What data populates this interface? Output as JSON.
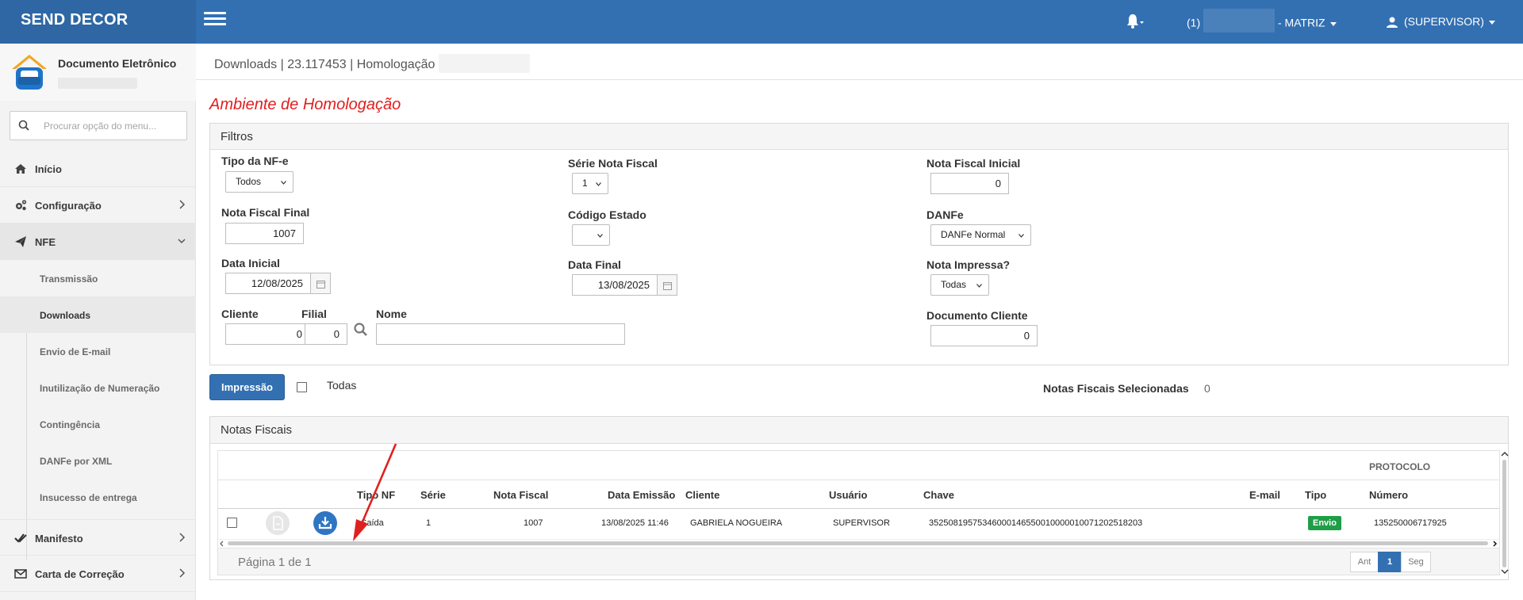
{
  "app": {
    "brand": "SEND DECOR",
    "company": "(1)",
    "company_suffix": "- MATRIZ",
    "user": "(SUPERVISOR)"
  },
  "sidebar": {
    "title": "Documento Eletrônico",
    "search_placeholder": "Procurar opção do menu...",
    "items": [
      {
        "label": "Início",
        "icon": "home-icon"
      },
      {
        "label": "Configuração",
        "icon": "gears-icon"
      },
      {
        "label": "NFE",
        "icon": "paper-plane-icon"
      },
      {
        "label": "Manifesto",
        "icon": "double-check-icon"
      },
      {
        "label": "Carta de Correção",
        "icon": "envelope-icon"
      }
    ],
    "submenu": [
      {
        "label": "Transmissão"
      },
      {
        "label": "Downloads"
      },
      {
        "label": "Envio de E-mail"
      },
      {
        "label": "Inutilização de Numeração"
      },
      {
        "label": "Contingência"
      },
      {
        "label": "DANFe por XML"
      },
      {
        "label": "Insucesso de entrega"
      }
    ]
  },
  "breadcrumb": "Downloads | 23.117453 | Homologação",
  "environment_title": "Ambiente de Homologação",
  "filters": {
    "title": "Filtros",
    "tipo_nfe": {
      "label": "Tipo da NF-e",
      "value": "Todos"
    },
    "serie": {
      "label": "Série Nota Fiscal",
      "value": "1"
    },
    "nf_inicial": {
      "label": "Nota Fiscal Inicial",
      "value": "0"
    },
    "nf_final": {
      "label": "Nota Fiscal Final",
      "value": "1007"
    },
    "codigo_estado": {
      "label": "Código Estado",
      "value": ""
    },
    "danfe": {
      "label": "DANFe",
      "value": "DANFe Normal"
    },
    "data_inicial": {
      "label": "Data Inicial",
      "value": "12/08/2025"
    },
    "data_final": {
      "label": "Data Final",
      "value": "13/08/2025"
    },
    "nota_impressa": {
      "label": "Nota Impressa?",
      "value": "Todas"
    },
    "cliente": {
      "label": "Cliente",
      "value": "0"
    },
    "filial": {
      "label": "Filial",
      "value": "0"
    },
    "nome": {
      "label": "Nome",
      "value": ""
    },
    "documento_cliente": {
      "label": "Documento Cliente",
      "value": "0"
    }
  },
  "actions": {
    "print_label": "Impressão",
    "all_label": "Todas",
    "selected_label": "Notas Fiscais Selecionadas",
    "selected_count": "0"
  },
  "notas": {
    "title": "Notas Fiscais",
    "group_header": "PROTOCOLO",
    "columns": [
      "Tipo NF",
      "Série",
      "Nota Fiscal",
      "Data Emissão",
      "Cliente",
      "Usuário",
      "Chave",
      "E-mail",
      "Tipo",
      "Número"
    ],
    "rows": [
      {
        "tipo_nf": "Saída",
        "serie": "1",
        "nota_fiscal": "1007",
        "data_emissao": "13/08/2025 11:46",
        "cliente": "GABRIELA NOGUEIRA",
        "usuario": "SUPERVISOR",
        "chave": "35250819575346000146550010000010071202518203",
        "email": "",
        "tipo": "Envio",
        "numero": "135250006717925"
      }
    ],
    "page_info": "Página 1 de 1",
    "pager": {
      "prev": "Ant",
      "current": "1",
      "next": "Seg"
    }
  },
  "colors": {
    "primary": "#3370b2",
    "env_title": "#e21d1d",
    "badge": "#1f9e47",
    "annotation_arrow": "#e02020"
  }
}
